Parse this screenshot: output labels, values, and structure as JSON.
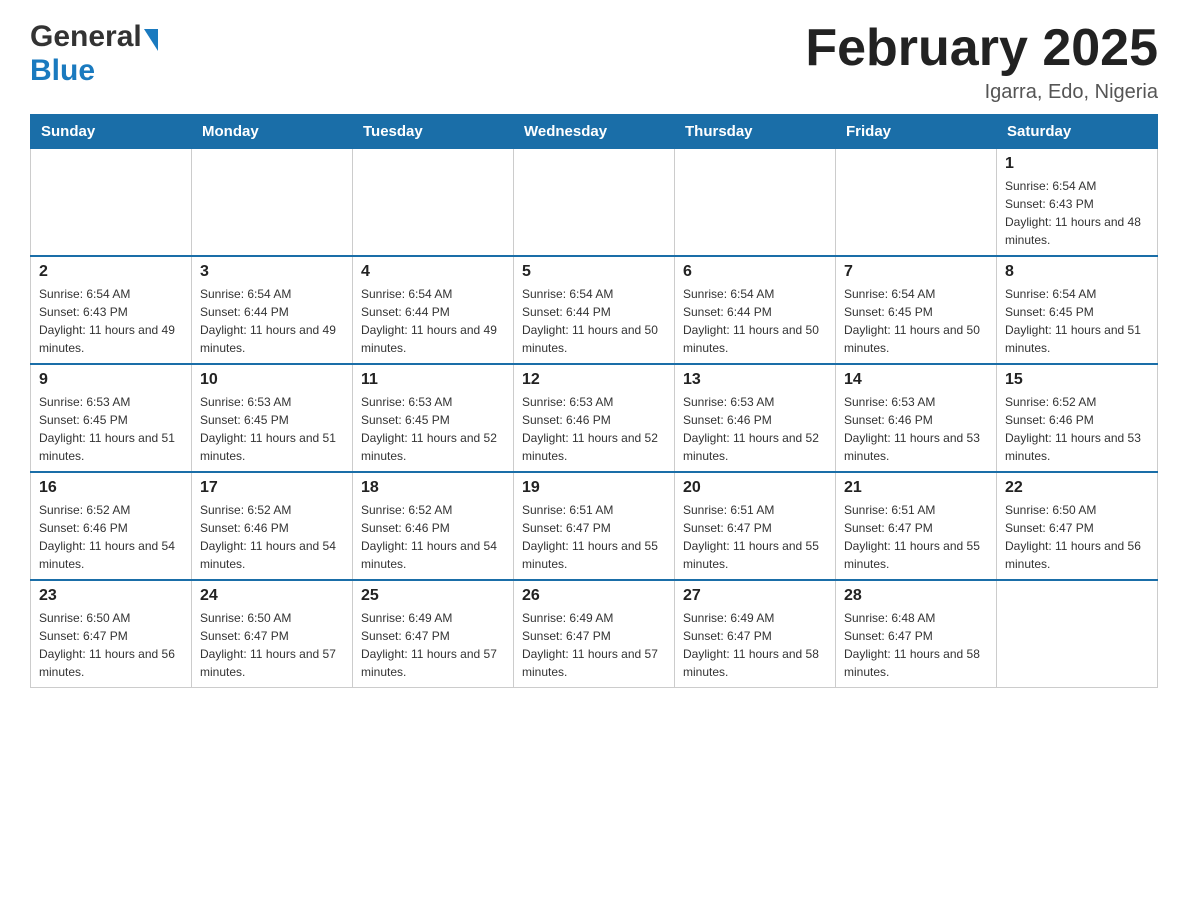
{
  "header": {
    "logo_general": "General",
    "logo_blue": "Blue",
    "month_title": "February 2025",
    "location": "Igarra, Edo, Nigeria"
  },
  "days_of_week": [
    "Sunday",
    "Monday",
    "Tuesday",
    "Wednesday",
    "Thursday",
    "Friday",
    "Saturday"
  ],
  "weeks": [
    {
      "days": [
        {
          "number": "",
          "sunrise": "",
          "sunset": "",
          "daylight": ""
        },
        {
          "number": "",
          "sunrise": "",
          "sunset": "",
          "daylight": ""
        },
        {
          "number": "",
          "sunrise": "",
          "sunset": "",
          "daylight": ""
        },
        {
          "number": "",
          "sunrise": "",
          "sunset": "",
          "daylight": ""
        },
        {
          "number": "",
          "sunrise": "",
          "sunset": "",
          "daylight": ""
        },
        {
          "number": "",
          "sunrise": "",
          "sunset": "",
          "daylight": ""
        },
        {
          "number": "1",
          "sunrise": "Sunrise: 6:54 AM",
          "sunset": "Sunset: 6:43 PM",
          "daylight": "Daylight: 11 hours and 48 minutes."
        }
      ]
    },
    {
      "days": [
        {
          "number": "2",
          "sunrise": "Sunrise: 6:54 AM",
          "sunset": "Sunset: 6:43 PM",
          "daylight": "Daylight: 11 hours and 49 minutes."
        },
        {
          "number": "3",
          "sunrise": "Sunrise: 6:54 AM",
          "sunset": "Sunset: 6:44 PM",
          "daylight": "Daylight: 11 hours and 49 minutes."
        },
        {
          "number": "4",
          "sunrise": "Sunrise: 6:54 AM",
          "sunset": "Sunset: 6:44 PM",
          "daylight": "Daylight: 11 hours and 49 minutes."
        },
        {
          "number": "5",
          "sunrise": "Sunrise: 6:54 AM",
          "sunset": "Sunset: 6:44 PM",
          "daylight": "Daylight: 11 hours and 50 minutes."
        },
        {
          "number": "6",
          "sunrise": "Sunrise: 6:54 AM",
          "sunset": "Sunset: 6:44 PM",
          "daylight": "Daylight: 11 hours and 50 minutes."
        },
        {
          "number": "7",
          "sunrise": "Sunrise: 6:54 AM",
          "sunset": "Sunset: 6:45 PM",
          "daylight": "Daylight: 11 hours and 50 minutes."
        },
        {
          "number": "8",
          "sunrise": "Sunrise: 6:54 AM",
          "sunset": "Sunset: 6:45 PM",
          "daylight": "Daylight: 11 hours and 51 minutes."
        }
      ]
    },
    {
      "days": [
        {
          "number": "9",
          "sunrise": "Sunrise: 6:53 AM",
          "sunset": "Sunset: 6:45 PM",
          "daylight": "Daylight: 11 hours and 51 minutes."
        },
        {
          "number": "10",
          "sunrise": "Sunrise: 6:53 AM",
          "sunset": "Sunset: 6:45 PM",
          "daylight": "Daylight: 11 hours and 51 minutes."
        },
        {
          "number": "11",
          "sunrise": "Sunrise: 6:53 AM",
          "sunset": "Sunset: 6:45 PM",
          "daylight": "Daylight: 11 hours and 52 minutes."
        },
        {
          "number": "12",
          "sunrise": "Sunrise: 6:53 AM",
          "sunset": "Sunset: 6:46 PM",
          "daylight": "Daylight: 11 hours and 52 minutes."
        },
        {
          "number": "13",
          "sunrise": "Sunrise: 6:53 AM",
          "sunset": "Sunset: 6:46 PM",
          "daylight": "Daylight: 11 hours and 52 minutes."
        },
        {
          "number": "14",
          "sunrise": "Sunrise: 6:53 AM",
          "sunset": "Sunset: 6:46 PM",
          "daylight": "Daylight: 11 hours and 53 minutes."
        },
        {
          "number": "15",
          "sunrise": "Sunrise: 6:52 AM",
          "sunset": "Sunset: 6:46 PM",
          "daylight": "Daylight: 11 hours and 53 minutes."
        }
      ]
    },
    {
      "days": [
        {
          "number": "16",
          "sunrise": "Sunrise: 6:52 AM",
          "sunset": "Sunset: 6:46 PM",
          "daylight": "Daylight: 11 hours and 54 minutes."
        },
        {
          "number": "17",
          "sunrise": "Sunrise: 6:52 AM",
          "sunset": "Sunset: 6:46 PM",
          "daylight": "Daylight: 11 hours and 54 minutes."
        },
        {
          "number": "18",
          "sunrise": "Sunrise: 6:52 AM",
          "sunset": "Sunset: 6:46 PM",
          "daylight": "Daylight: 11 hours and 54 minutes."
        },
        {
          "number": "19",
          "sunrise": "Sunrise: 6:51 AM",
          "sunset": "Sunset: 6:47 PM",
          "daylight": "Daylight: 11 hours and 55 minutes."
        },
        {
          "number": "20",
          "sunrise": "Sunrise: 6:51 AM",
          "sunset": "Sunset: 6:47 PM",
          "daylight": "Daylight: 11 hours and 55 minutes."
        },
        {
          "number": "21",
          "sunrise": "Sunrise: 6:51 AM",
          "sunset": "Sunset: 6:47 PM",
          "daylight": "Daylight: 11 hours and 55 minutes."
        },
        {
          "number": "22",
          "sunrise": "Sunrise: 6:50 AM",
          "sunset": "Sunset: 6:47 PM",
          "daylight": "Daylight: 11 hours and 56 minutes."
        }
      ]
    },
    {
      "days": [
        {
          "number": "23",
          "sunrise": "Sunrise: 6:50 AM",
          "sunset": "Sunset: 6:47 PM",
          "daylight": "Daylight: 11 hours and 56 minutes."
        },
        {
          "number": "24",
          "sunrise": "Sunrise: 6:50 AM",
          "sunset": "Sunset: 6:47 PM",
          "daylight": "Daylight: 11 hours and 57 minutes."
        },
        {
          "number": "25",
          "sunrise": "Sunrise: 6:49 AM",
          "sunset": "Sunset: 6:47 PM",
          "daylight": "Daylight: 11 hours and 57 minutes."
        },
        {
          "number": "26",
          "sunrise": "Sunrise: 6:49 AM",
          "sunset": "Sunset: 6:47 PM",
          "daylight": "Daylight: 11 hours and 57 minutes."
        },
        {
          "number": "27",
          "sunrise": "Sunrise: 6:49 AM",
          "sunset": "Sunset: 6:47 PM",
          "daylight": "Daylight: 11 hours and 58 minutes."
        },
        {
          "number": "28",
          "sunrise": "Sunrise: 6:48 AM",
          "sunset": "Sunset: 6:47 PM",
          "daylight": "Daylight: 11 hours and 58 minutes."
        },
        {
          "number": "",
          "sunrise": "",
          "sunset": "",
          "daylight": ""
        }
      ]
    }
  ]
}
